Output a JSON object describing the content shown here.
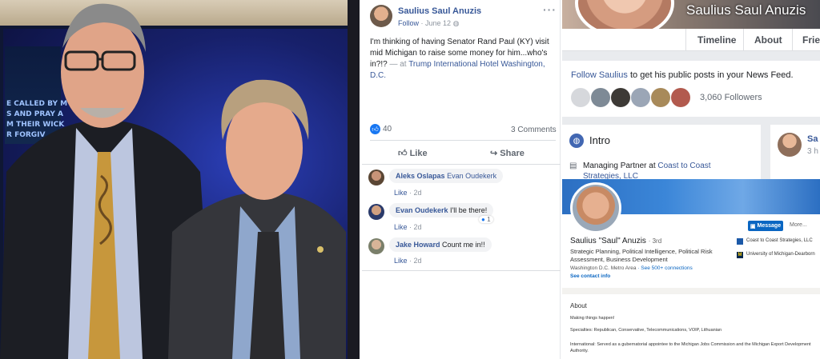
{
  "photo": {
    "screen_text": "E CALLED BY MY\nS AND PRAY A\nM THEIR WICK\nR FORGIV"
  },
  "post": {
    "author": "Saulius Saul Anuzis",
    "follow_label": "Follow",
    "date": "June 12",
    "text_main": "I'm thinking of having Senator Rand Paul (KY) visit mid Michigan to raise some money for him...who's in?!?",
    "at_prefix": " — at ",
    "place": "Trump International Hotel Washington, D.C.",
    "reaction_count": "40",
    "comments_count": "3 Comments",
    "like_button": "Like",
    "share_button": "Share",
    "comments": [
      {
        "name": "Aleks Oslapas",
        "text": "Evan Oudekerk",
        "text_is_tag": true,
        "like": "Like",
        "time": "2d"
      },
      {
        "name": "Evan Oudekerk",
        "text": "I'll be there!",
        "text_is_tag": false,
        "like": "Like",
        "time": "2d",
        "reactions": "1"
      },
      {
        "name": "Jake Howard",
        "text": "Count me in!!",
        "text_is_tag": false,
        "like": "Like",
        "time": "2d"
      }
    ]
  },
  "profile": {
    "name": "Saulius Saul Anuzis",
    "tabs": [
      "Timeline",
      "About",
      "Frie"
    ],
    "follow_prompt_link": "Follow Saulius",
    "follow_prompt_text": " to get his public posts in your News Feed.",
    "followers": "3,060 Followers",
    "intro_title": "Intro",
    "work_prefix": "Managing Partner at ",
    "work_company": "Coast to Coast Strategies, LLC",
    "side_card_name": "Sa",
    "side_card_sub": "3 h"
  },
  "linkedin": {
    "name": "Saulius \"Saul\" Anuzis",
    "degree": "· 3rd",
    "headline": "Strategic Planning, Political Intelligence, Political Risk Assessment, Business Development",
    "location": "Washington D.C. Metro Area",
    "connections": "· See 500+ connections",
    "contact": "See contact info",
    "message_button": "Message",
    "more_button": "More...",
    "company1": "Coast to Coast Strategies, LLC",
    "school1": "University of Michigan-Dearborn",
    "about_title": "About",
    "about_line1": "Making things happen!",
    "about_line2": "Specialties: Republican, Conservative, Telecommunications, VOIP, Lithuanian",
    "about_line3": "International: Served as a gubernatorial appointee to the Michigan Jobs Commission and the Michigan Export Development Authority."
  },
  "colors": {
    "fb_blue": "#385898",
    "linkedin_blue": "#0a66c2",
    "reaction_blue": "#1877f2"
  }
}
